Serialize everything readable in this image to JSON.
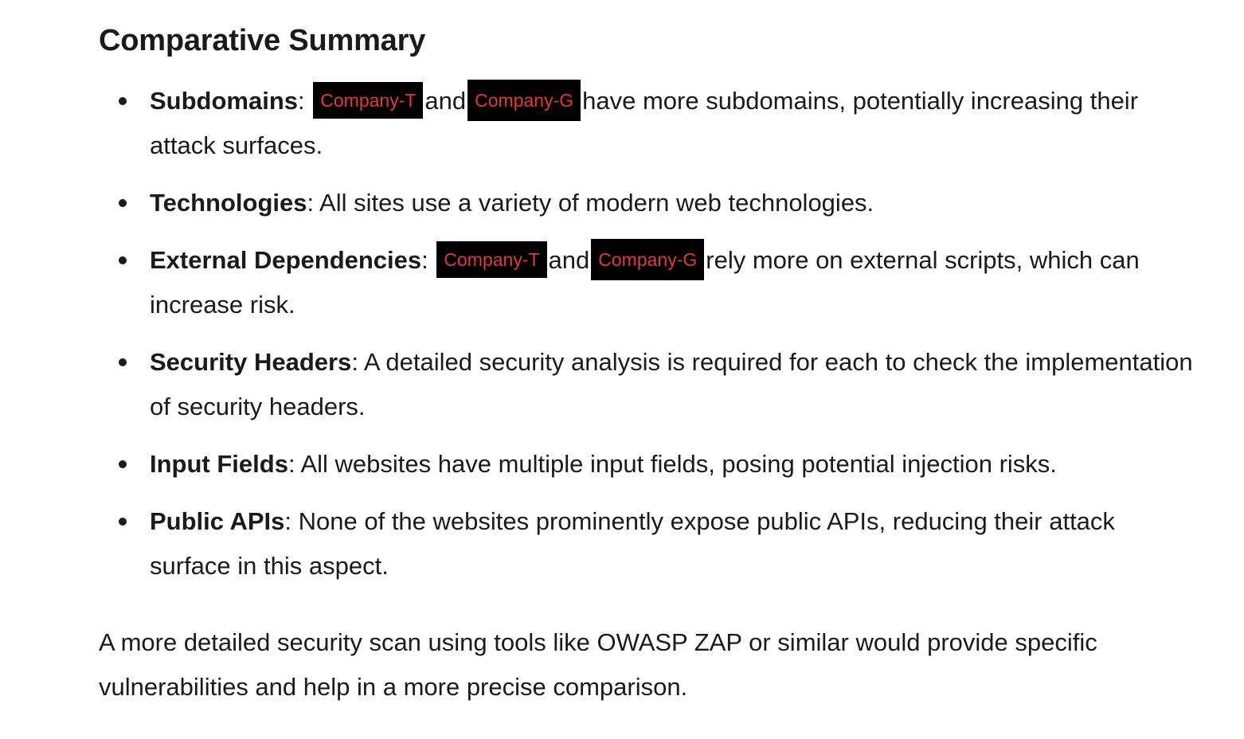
{
  "heading": "Comparative Summary",
  "items": [
    {
      "term": "Subdomains",
      "sep": ":",
      "redact_a": "Company-T",
      "mid": "and",
      "redact_b": "Company-G",
      "text": "have more subdomains, potentially increasing their attack surfaces."
    },
    {
      "term": "Technologies",
      "text": ": All sites use a variety of modern web technologies."
    },
    {
      "term": "External Dependencies",
      "sep": ":",
      "redact_a": "Company-T",
      "mid": "and",
      "redact_b": "Company-G",
      "text": "rely more on external scripts, which can increase risk."
    },
    {
      "term": "Security Headers",
      "text": ": A detailed security analysis is required for each to check the implementation of security headers."
    },
    {
      "term": "Input Fields",
      "text": ": All websites have multiple input fields, posing potential injection risks."
    },
    {
      "term": "Public APIs",
      "text": ": None of the websites prominently expose public APIs, reducing their attack surface in this aspect."
    }
  ],
  "closing": "A more detailed security scan using tools like OWASP ZAP or similar would provide specific vulnerabilities and help in a more precise comparison.",
  "colors": {
    "text": "#1a1a1a",
    "redaction_bg": "#000000",
    "redaction_text": "#e53935"
  }
}
